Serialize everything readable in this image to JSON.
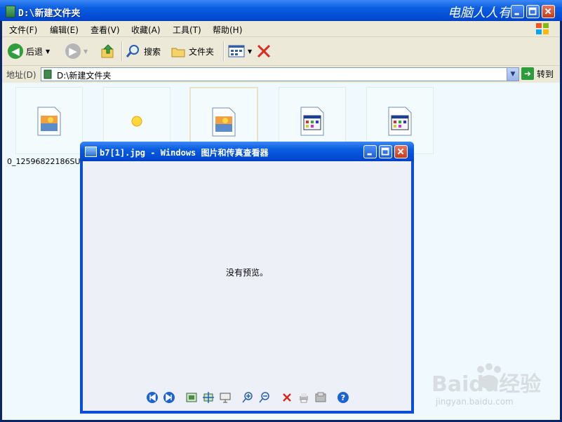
{
  "window": {
    "title": "D:\\新建文件夹",
    "watermark_title": "电脑人人有"
  },
  "menu": [
    "文件(F)",
    "编辑(E)",
    "查看(V)",
    "收藏(A)",
    "工具(T)",
    "帮助(H)"
  ],
  "toolbar": {
    "back_label": "后退",
    "search_label": "搜索",
    "folders_label": "文件夹"
  },
  "address": {
    "label": "地址(D)",
    "value": "D:\\新建文件夹",
    "go_label": "转到"
  },
  "files": {
    "first_filename": "0_12596822186SU2...",
    "icons": [
      "image-file-icon",
      "sun-image-icon",
      "image-file-icon",
      "window-file-icon",
      "window-file-icon"
    ]
  },
  "viewer": {
    "title": "b7[1].jpg - Windows 图片和传真查看器",
    "message": "没有预览。",
    "tools": [
      "previous-image-icon",
      "next-image-icon",
      "best-fit-icon",
      "actual-size-icon",
      "slideshow-icon",
      "zoom-in-icon",
      "zoom-out-icon",
      "delete-icon",
      "print-icon",
      "copy-to-icon",
      "help-icon"
    ]
  },
  "watermark": {
    "brand": "Baidu经验",
    "url": "jingyan.baidu.com"
  },
  "colors": {
    "titlebar": "#0a5ce0",
    "chrome": "#ece9d8",
    "content_bg": "#f0fafe",
    "close_red": "#c63b1b"
  }
}
